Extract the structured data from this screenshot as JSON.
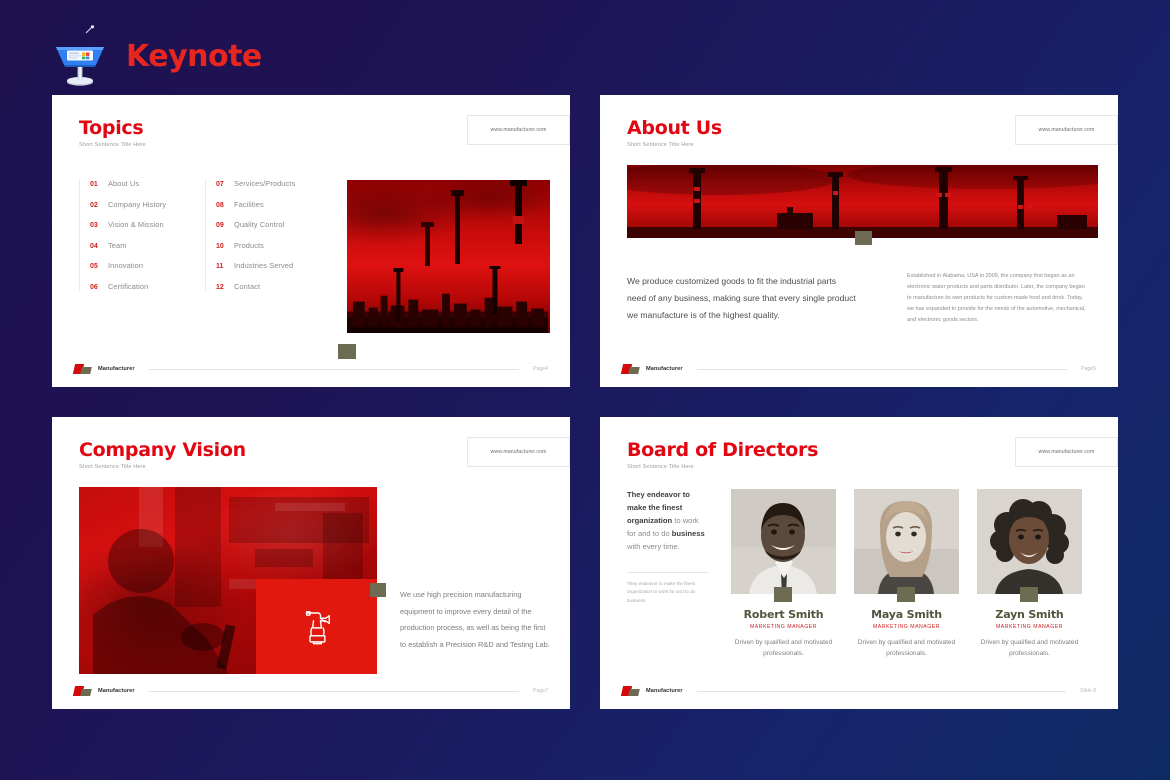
{
  "header": {
    "app_icon": "keynote-podium-icon",
    "title": "Keynote",
    "title_color": "#e8261f"
  },
  "theme": {
    "background_start": "#1d1150",
    "background_end": "#0f2a63",
    "accent_red": "#e20613",
    "marker_olive": "#6d6c52",
    "brand_name": "Manufacturer"
  },
  "common": {
    "subtitle": "Short Sentence Title Here",
    "url": "www.manufacturer.com",
    "logo_text": "Manufacturer"
  },
  "slides": [
    {
      "id": "topics",
      "title": "Topics",
      "subtitle": "Short Sentence Title Here",
      "url": "www.manufacturer.com",
      "page_label": "Page4",
      "topics_left": [
        {
          "num": "01",
          "label": "About Us"
        },
        {
          "num": "02",
          "label": "Company History"
        },
        {
          "num": "03",
          "label": "Vision & Mission"
        },
        {
          "num": "04",
          "label": "Team"
        },
        {
          "num": "05",
          "label": "Innovation"
        },
        {
          "num": "06",
          "label": "Certification"
        }
      ],
      "topics_right": [
        {
          "num": "07",
          "label": "Services/Products"
        },
        {
          "num": "08",
          "label": "Facilities"
        },
        {
          "num": "09",
          "label": "Quality Control"
        },
        {
          "num": "10",
          "label": "Products"
        },
        {
          "num": "11",
          "label": "Industries Served"
        },
        {
          "num": "12",
          "label": "Contact"
        }
      ],
      "image_alt": "red-tinted-factory-refinery-photo"
    },
    {
      "id": "about-us",
      "title": "About Us",
      "subtitle": "Short Sentence Title Here",
      "url": "www.manufacturer.com",
      "page_label": "Page5",
      "body": "We produce customized goods to fit the industrial parts need of any business, making sure that every single product we manufacture is of the highest quality.",
      "side_text": "Established in Alabama, USA in 2009, the company first began as an electronic water products and parts distributor. Later, the company began to manufacture its own products for custom-made food and drink. Today, we has expanded to provide for the needs of the automotive, mechanical, and electronic goods sectors.",
      "image_alt": "red-tinted-industrial-smokestacks-banner"
    },
    {
      "id": "company-vision",
      "title": "Company Vision",
      "subtitle": "Short Sentence Title Here",
      "url": "www.manufacturer.com",
      "page_label": "Page7",
      "body": "We use high precision manufacturing equipment to improve every detail of the production process, as well as being the first to establish a Precision R&D and Testing Lab.",
      "image_alt": "red-tinted-cleanroom-technician-photo",
      "icon": "spray-gun-icon"
    },
    {
      "id": "board-of-directors",
      "title": "Board of Directors",
      "subtitle": "Short Sentence Title Here",
      "url": "www.manufacturer.com",
      "page_label": "Slide 8",
      "lead_html": "They endeavor to make the finest organization to work for and to do business with every time.",
      "note": "They endeavor to make the finest organization to work for and to do business.",
      "people": [
        {
          "name": "Robert Smith",
          "role": "MARKETING MANAGER",
          "desc": "Driven by qualified and motivated professionals.",
          "avatar": "portrait-man-bearded-grayscale"
        },
        {
          "name": "Maya Smith",
          "role": "MARKETING MANAGER",
          "desc": "Driven by qualified and motivated professionals.",
          "avatar": "portrait-woman-long-hair-grayscale"
        },
        {
          "name": "Zayn Smith",
          "role": "MARKETING MANAGER",
          "desc": "Driven by qualified and motivated professionals.",
          "avatar": "portrait-woman-curly-hair-grayscale"
        }
      ]
    }
  ]
}
